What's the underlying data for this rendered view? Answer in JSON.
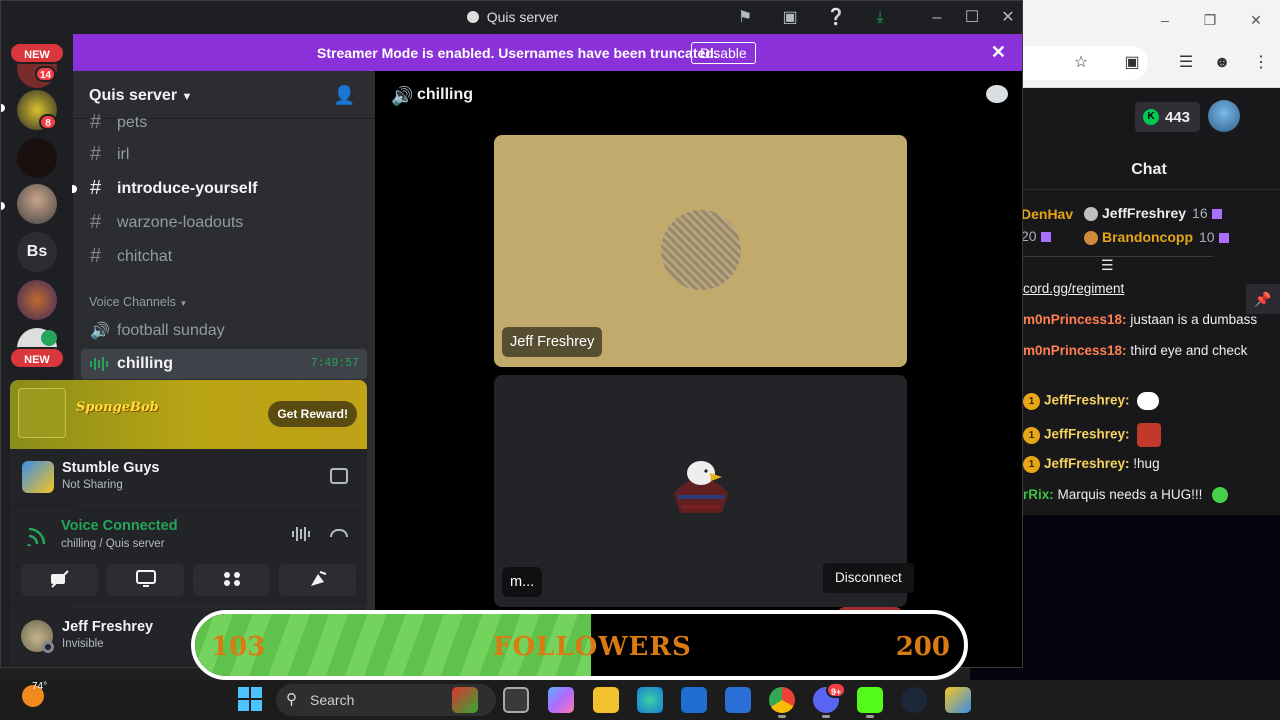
{
  "discord": {
    "window_title": "Quis server",
    "streamer_notice": "Streamer Mode is enabled. Usernames have been truncated.",
    "disable_label": "Disable",
    "rail": {
      "new_badge": "NEW",
      "new_badge_bottom": "NEW",
      "mention_1": "14",
      "mention_2": "8",
      "server_initials": "Bs"
    },
    "server_name": "Quis server",
    "channels": [
      {
        "name": "pets",
        "type": "text",
        "unread": false
      },
      {
        "name": "irl",
        "type": "text",
        "unread": false
      },
      {
        "name": "introduce-yourself",
        "type": "text",
        "unread": true
      },
      {
        "name": "warzone-loadouts",
        "type": "text",
        "unread": false
      },
      {
        "name": "chitchat",
        "type": "text",
        "unread": false
      }
    ],
    "voice_category": "Voice Channels",
    "voice_channels": [
      {
        "name": "football sunday",
        "active": false
      },
      {
        "name": "chilling",
        "active": true,
        "duration": "7:49:57"
      }
    ],
    "promo": {
      "logo_text": "SpongeBob",
      "reward_label": "Get Reward!"
    },
    "activity": {
      "game": "Stumble Guys",
      "status": "Not Sharing"
    },
    "voice": {
      "title": "Voice Connected",
      "location": "chilling / Quis server"
    },
    "user": {
      "name": "Jeff Freshrey",
      "status": "Invisible"
    },
    "stage": {
      "channel": "chilling",
      "tile1_name": "Jeff Freshrey",
      "tile2_name": "m..."
    },
    "disconnect_tooltip": "Disconnect",
    "colors": {
      "accent": "#8b31d9",
      "voice_green": "#23a55a",
      "danger": "#a12d2f"
    }
  },
  "goal": {
    "current": "103",
    "label": "FOLLOWERS",
    "target": "200",
    "progress": 0.515
  },
  "twitch": {
    "points": "443",
    "chat_title": "Chat",
    "gifters": [
      {
        "name": "DenHav",
        "count": "20"
      },
      {
        "name": "JeffFreshrey",
        "count": "16"
      },
      {
        "name": "Brandoncopp",
        "count": "10"
      }
    ],
    "messages": [
      {
        "user": "",
        "text": "cord.gg/regiment",
        "link": true
      },
      {
        "user": "m0nPrincess18:",
        "text": " justaan is a dumbass",
        "color": "#ff7f50"
      },
      {
        "user": "m0nPrincess18:",
        "text": " third eye and check",
        "color": "#ff7f50"
      },
      {
        "user": "JeffFreshrey:",
        "text": "",
        "color": "#f4d35e",
        "badge": "1",
        "emote": "speech-bubble-emote"
      },
      {
        "user": "JeffFreshrey:",
        "text": "",
        "color": "#f4d35e",
        "badge": "1",
        "emote": "face-emote"
      },
      {
        "user": "JeffFreshrey:",
        "text": " !hug",
        "color": "#f4d35e",
        "badge": "1"
      },
      {
        "user": "rRix:",
        "text": " Marquis needs a HUG!!!",
        "color": "#3fbf3f",
        "emote": "smile-emote"
      }
    ]
  },
  "taskbar": {
    "temperature": "74°",
    "search_placeholder": "Search",
    "discord_badge": "9+"
  }
}
